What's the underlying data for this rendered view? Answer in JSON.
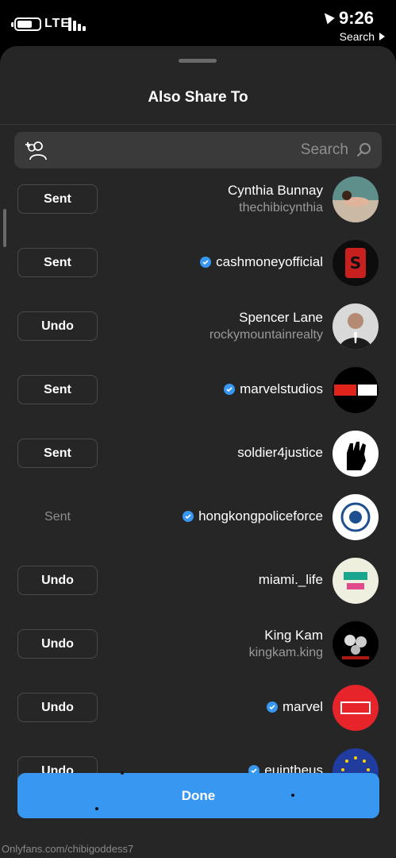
{
  "status_bar": {
    "time": "9:26",
    "network": "LTE",
    "back_label": "Search"
  },
  "sheet": {
    "title": "Also Share To",
    "search_placeholder": "Search",
    "done_label": "Done",
    "watermark": "Onlyfans.com/chibigoddess7"
  },
  "contacts": [
    {
      "name": "Cynthia Bunnay",
      "handle": "thechibicynthia",
      "verified": false,
      "action": "Sent"
    },
    {
      "name": "cashmoneyofficial",
      "handle": "",
      "verified": true,
      "action": "Sent"
    },
    {
      "name": "Spencer Lane",
      "handle": "rockymountainrealty",
      "verified": false,
      "action": "Undo"
    },
    {
      "name": "marvelstudios",
      "handle": "",
      "verified": true,
      "action": "Sent"
    },
    {
      "name": "soldier4justice",
      "handle": "",
      "verified": false,
      "action": "Sent"
    },
    {
      "name": "hongkongpoliceforce",
      "handle": "",
      "verified": true,
      "action": "Sent"
    },
    {
      "name": "miami._life",
      "handle": "",
      "verified": false,
      "action": "Undo"
    },
    {
      "name": "King Kam",
      "handle": "kingkam.king",
      "verified": false,
      "action": "Undo"
    },
    {
      "name": "marvel",
      "handle": "",
      "verified": true,
      "action": "Undo"
    },
    {
      "name": "euintheus",
      "handle": "",
      "verified": true,
      "action": "Undo"
    }
  ],
  "colors": {
    "sheet_bg": "#262626",
    "accent_blue": "#3897f0",
    "verified_blue": "#3897f0",
    "muted_text": "#9a9a9a"
  }
}
